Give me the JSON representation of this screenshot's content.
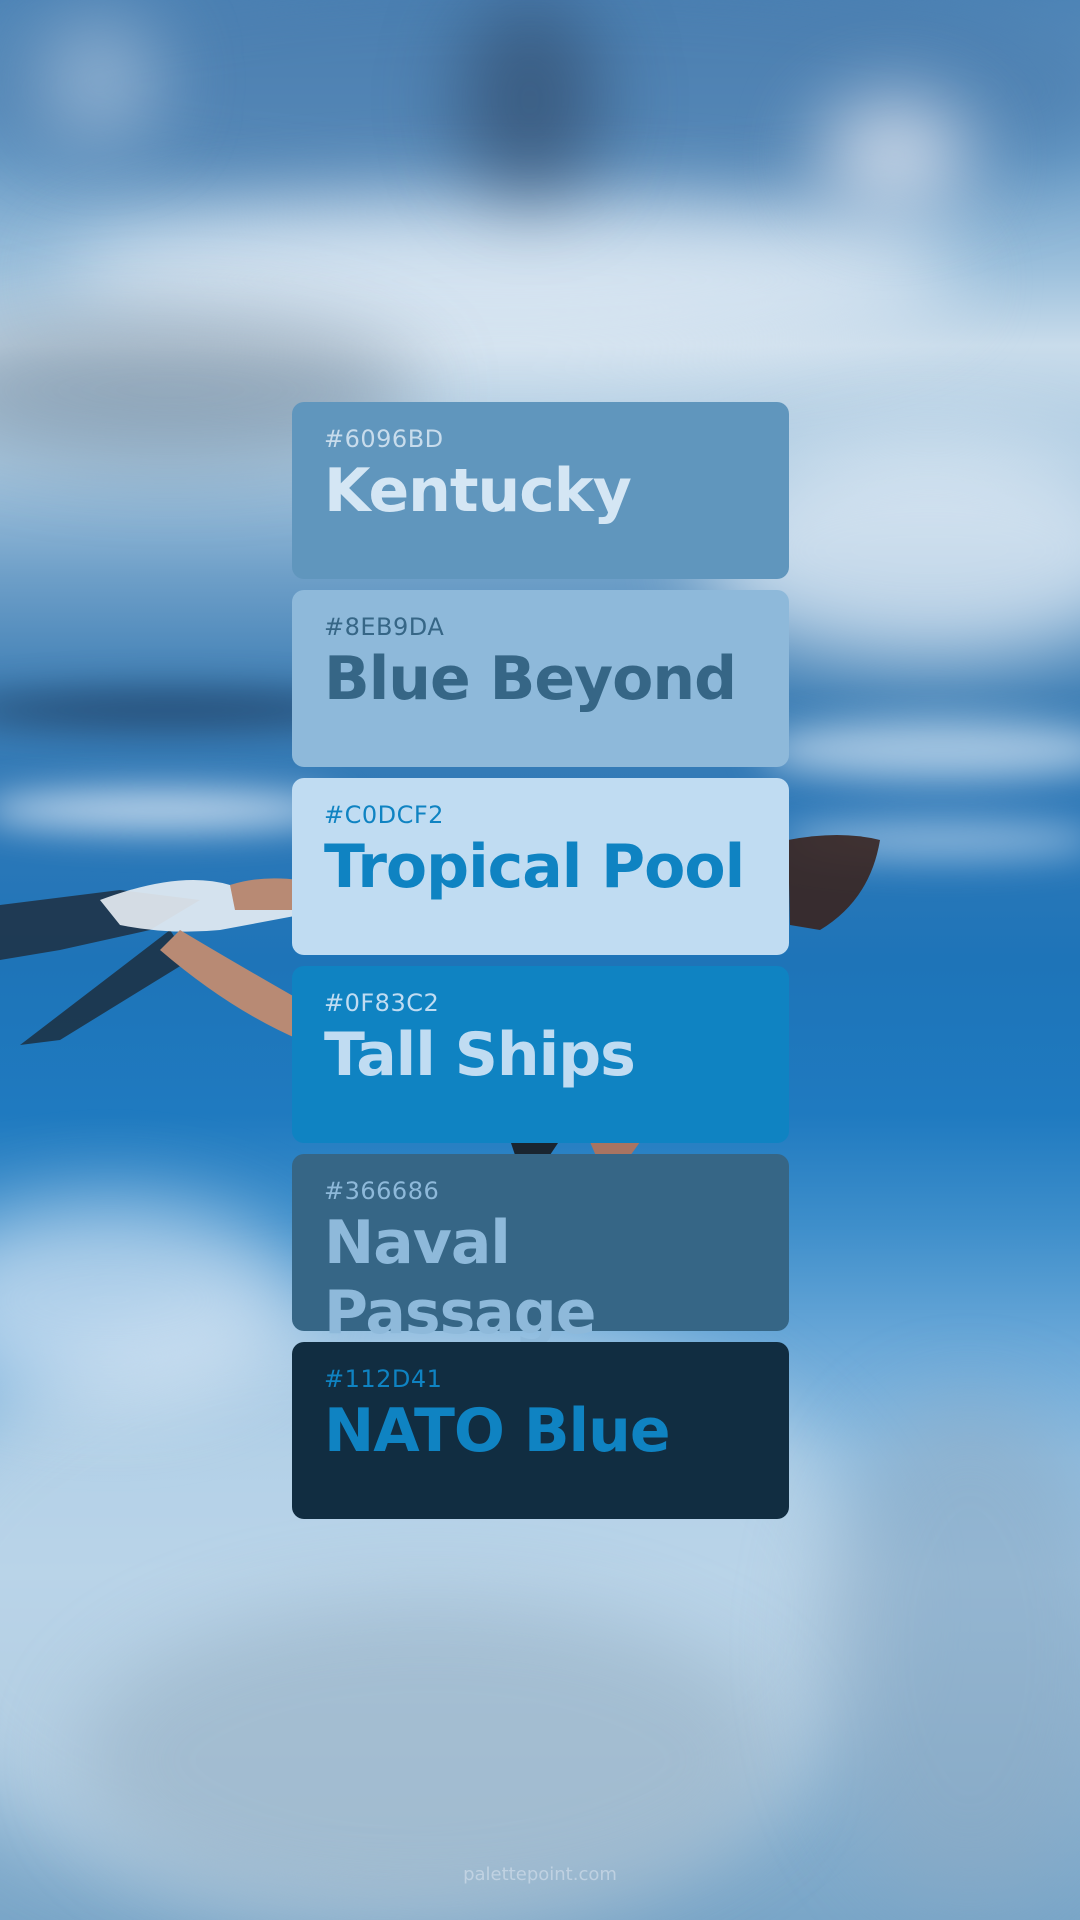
{
  "palette": [
    {
      "hex": "#6096BD",
      "name": "Kentucky",
      "bg": "#6096BD",
      "hex_color": "#C8DCEC",
      "name_color": "#D4E6F4"
    },
    {
      "hex": "#8EB9DA",
      "name": "Blue Beyond",
      "bg": "#8EB9DA",
      "hex_color": "#366686",
      "name_color": "#366686"
    },
    {
      "hex": "#C0DCF2",
      "name": "Tropical Pool",
      "bg": "#C0DCF2",
      "hex_color": "#0F83C2",
      "name_color": "#0F83C2"
    },
    {
      "hex": "#0F83C2",
      "name": "Tall Ships",
      "bg": "#0F83C2",
      "hex_color": "#C0DCF2",
      "name_color": "#C0DCF2"
    },
    {
      "hex": "#366686",
      "name": "Naval Passage",
      "bg": "#366686",
      "hex_color": "#8EB9DA",
      "name_color": "#8EB9DA"
    },
    {
      "hex": "#112D41",
      "name": "NATO Blue",
      "bg": "#112D41",
      "hex_color": "#0F83C2",
      "name_color": "#0F83C2"
    }
  ],
  "footer": {
    "text": "palettepoint.com"
  },
  "background": {
    "subject": "underwater-snorkeler-photo"
  }
}
